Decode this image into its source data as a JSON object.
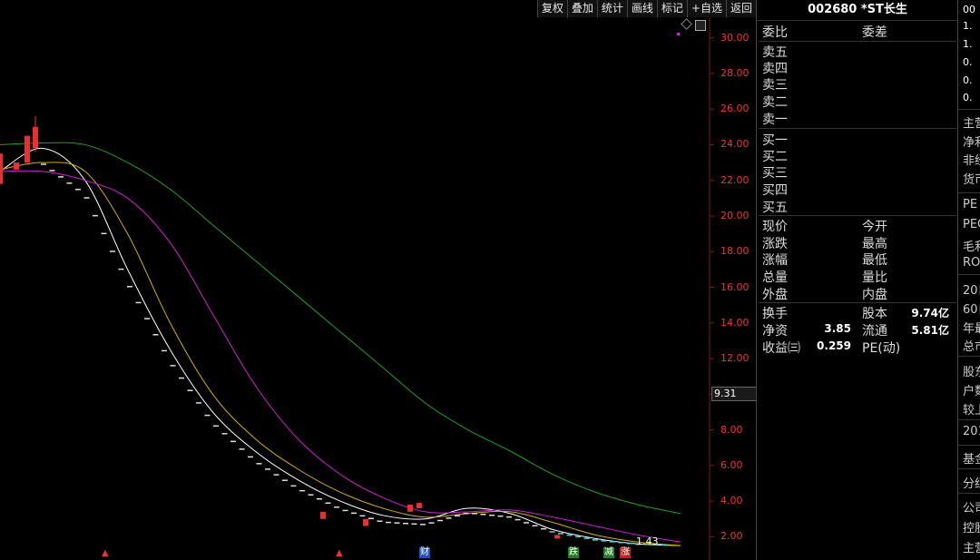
{
  "toolbar": {
    "items": [
      "复权",
      "叠加",
      "统计",
      "画线",
      "标记",
      "+自选",
      "返回"
    ]
  },
  "chart": {
    "current_price_tag": "9.31",
    "low_price_label": "1.43",
    "event_markers": [
      "财",
      "跌",
      "减",
      "涨"
    ]
  },
  "chart_data": {
    "type": "line",
    "ylim": [
      1,
      31
    ],
    "ylabels": [
      "30.00",
      "28.00",
      "26.00",
      "24.00",
      "22.00",
      "20.00",
      "18.00",
      "16.00",
      "14.00",
      "12.00",
      "10.00",
      "8.00",
      "6.00",
      "4.00",
      "2.00"
    ],
    "series": [
      {
        "color": "#ffffff",
        "values": [
          22.5,
          23.8,
          22.0,
          17.0,
          12.5,
          9.0,
          6.8,
          5.2,
          4.0,
          3.2,
          3.0,
          3.6,
          3.3,
          2.4,
          1.9,
          1.6,
          1.5
        ]
      },
      {
        "color": "#d4b000",
        "values": [
          22.6,
          23.0,
          22.5,
          19.0,
          14.0,
          10.0,
          7.5,
          5.8,
          4.5,
          3.6,
          3.1,
          3.3,
          3.4,
          2.8,
          2.1,
          1.7,
          1.5
        ]
      },
      {
        "color": "#d020d0",
        "values": [
          22.5,
          22.5,
          22.0,
          21.0,
          18.5,
          14.5,
          10.5,
          7.5,
          5.5,
          4.2,
          3.4,
          3.4,
          3.5,
          3.1,
          2.6,
          2.1,
          1.7
        ]
      },
      {
        "color": "#20a020",
        "values": [
          24.0,
          24.1,
          24.0,
          23.0,
          21.5,
          19.5,
          17.5,
          15.5,
          13.5,
          11.5,
          9.5,
          8.0,
          6.8,
          5.5,
          4.5,
          3.8,
          3.3
        ]
      }
    ]
  },
  "quote": {
    "title": "002680 *ST长生",
    "wei_bi": "委比",
    "wei_cha": "委差",
    "sell": [
      "卖五",
      "卖四",
      "卖三",
      "卖二",
      "卖一"
    ],
    "buy": [
      "买一",
      "买二",
      "买三",
      "买四",
      "买五"
    ],
    "left_labels": [
      "现价",
      "涨跌",
      "涨幅",
      "总量",
      "外盘"
    ],
    "right_labels": [
      "今开",
      "最高",
      "最低",
      "量比",
      "内盘"
    ],
    "huan_shou": "换手",
    "gu_ben": "股本",
    "gu_ben_val": "9.74亿",
    "jing_zi": "净资",
    "jing_zi_val": "3.85",
    "liu_tong": "流通",
    "liu_tong_val": "5.81亿",
    "shou_yi": "收益㈢",
    "shou_yi_val": "0.259",
    "pe": "PE(动)"
  },
  "right_panel": {
    "top_items": [
      "00",
      "1.",
      "1.",
      "0.",
      "0.",
      "0."
    ],
    "items": [
      "主营",
      "净利",
      "非经",
      "货币",
      "PE",
      "PEG",
      "毛利",
      "ROE",
      "20日",
      "60日",
      "年最",
      "总市",
      "股东",
      "户数",
      "较上",
      "201",
      "基金",
      "分红",
      "公司",
      "控股",
      "主营"
    ]
  }
}
